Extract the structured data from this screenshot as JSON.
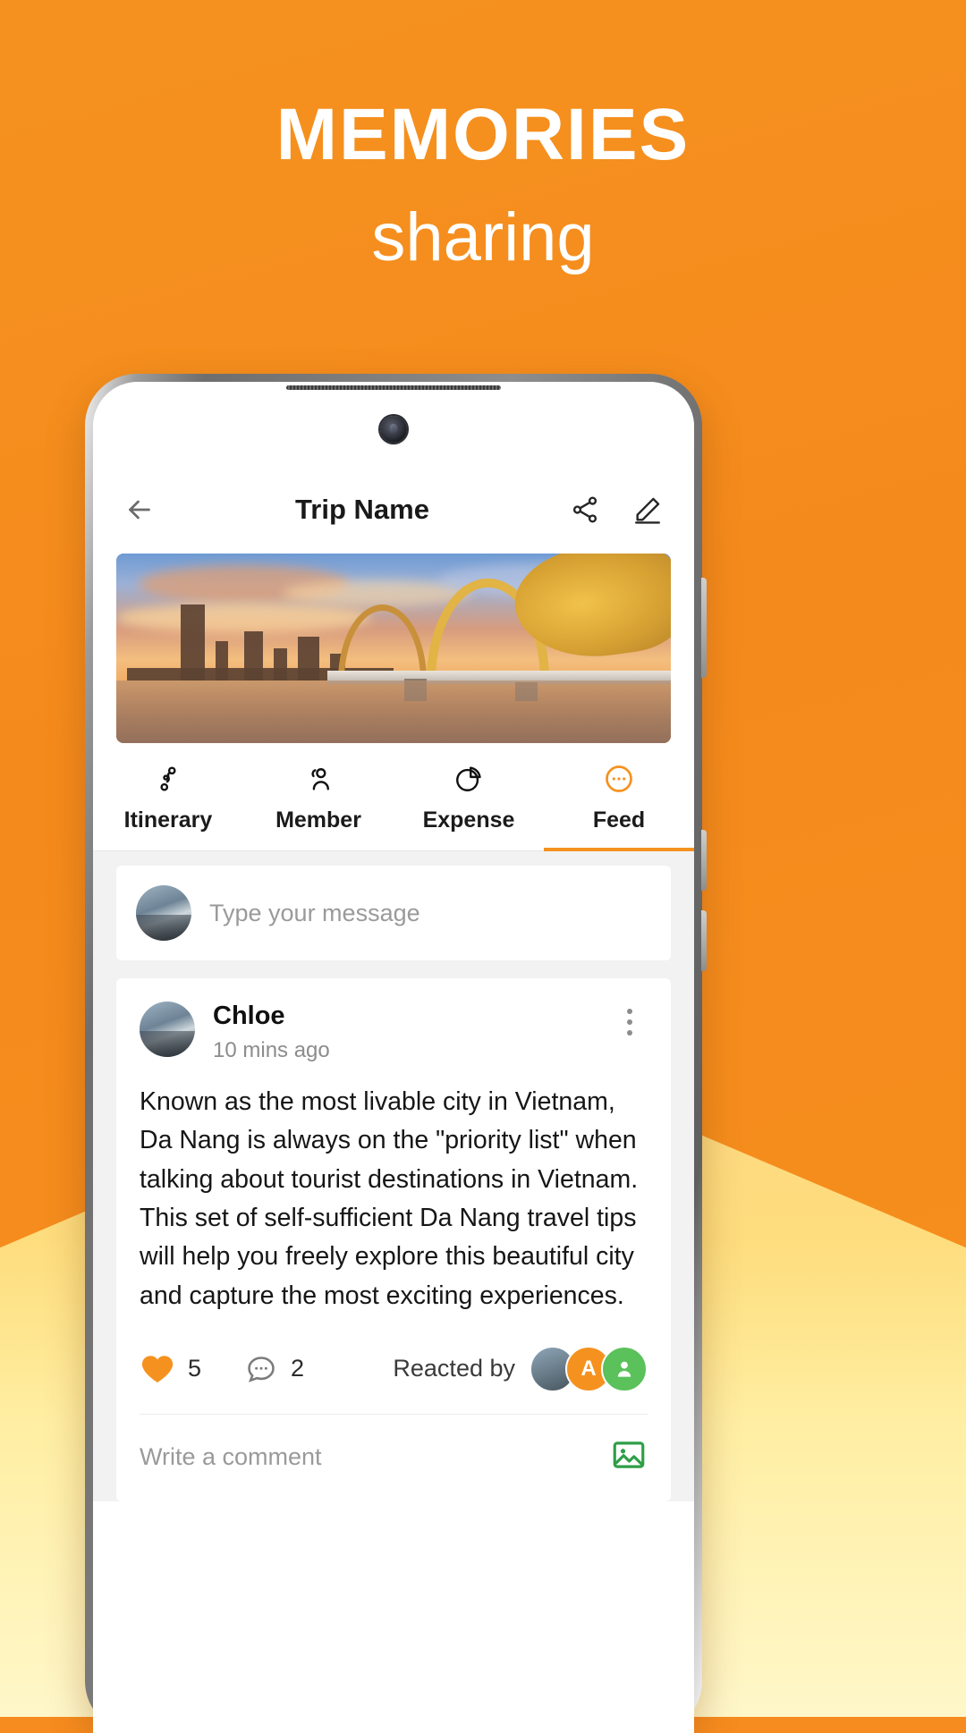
{
  "promo": {
    "title": "MEMORIES",
    "subtitle": "sharing",
    "bg_color": "#F5921F",
    "accent_color": "#F5921F"
  },
  "app": {
    "header": {
      "back_icon": "arrow-left-icon",
      "title": "Trip Name",
      "share_icon": "share-icon",
      "edit_icon": "pencil-icon"
    },
    "hero": {
      "alt": "Dragon Bridge Da Nang at sunset"
    },
    "tabs": [
      {
        "label": "Itinerary",
        "icon": "route-icon",
        "active": false
      },
      {
        "label": "Member",
        "icon": "people-icon",
        "active": false
      },
      {
        "label": "Expense",
        "icon": "pie-chart-icon",
        "active": false
      },
      {
        "label": "Feed",
        "icon": "chat-bubble-icon",
        "active": true
      }
    ],
    "composer": {
      "placeholder": "Type your message",
      "avatar": "user-avatar"
    },
    "post": {
      "author": "Chloe",
      "time": "10 mins ago",
      "menu_icon": "more-vertical-icon",
      "body": "Known as the most livable city in Vietnam, Da Nang is always on the \"priority list\" when talking about tourist destinations in Vietnam. This set of self-sufficient Da Nang travel tips will help you freely explore this beautiful city and capture the most exciting experiences.",
      "like_icon": "heart-icon",
      "like_count": "5",
      "comment_icon": "comment-icon",
      "comment_count": "2",
      "reacted_label": "Reacted by",
      "reactors": [
        {
          "type": "photo",
          "initial": ""
        },
        {
          "type": "orange",
          "initial": "A"
        },
        {
          "type": "green",
          "initial": ""
        }
      ],
      "comment_placeholder": "Write a comment",
      "image_icon": "image-icon"
    }
  }
}
